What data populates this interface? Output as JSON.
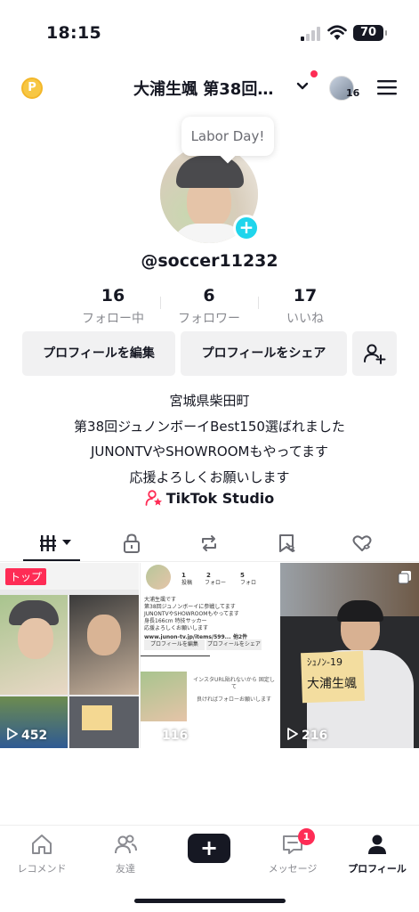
{
  "status": {
    "time": "18:15",
    "battery": "70"
  },
  "header": {
    "title": "大浦生颯 第38回…",
    "avatar_count": "16",
    "coin_label": "P"
  },
  "tooltip": "Labor Day!",
  "profile": {
    "username": "@soccer11232",
    "stats": [
      {
        "num": "16",
        "label": "フォロー中"
      },
      {
        "num": "6",
        "label": "フォロワー"
      },
      {
        "num": "17",
        "label": "いいね"
      }
    ],
    "buttons": {
      "edit": "プロフィールを編集",
      "share": "プロフィールをシェア"
    },
    "bio": [
      "宮城県柴田町",
      "第38回ジュノンボーイBest150選ばれました",
      "JUNONTVやSHOWROOMもやってます",
      "応援よろしくお願いします"
    ],
    "studio": "TikTok Studio"
  },
  "videos": [
    {
      "badge": "トップ",
      "views": "452"
    },
    {
      "views": "116"
    },
    {
      "views": "216"
    }
  ],
  "tile2_text": {
    "stats": [
      "1",
      "2",
      "5"
    ],
    "stat_labels": [
      "投稿",
      "フォロー",
      "フォロ"
    ],
    "bio": [
      "大浦生颯です",
      "第38回ジュノンボーイに参戦してます",
      "JUNONTVやSHOWROOMもやってます",
      "身長166cm 特技サッカー",
      "応援よろしくお願いします"
    ],
    "link": "www.junon-tv.jp/items/599...",
    "other": "他2件",
    "btn_edit": "プロフィールを編集",
    "btn_share": "プロフィールをシェア",
    "note": "インスタURL貼れないから 固定して",
    "note2": "良ければフォローお願いします"
  },
  "tile3_sign": [
    "ｼｭﾉﾝ-19",
    "大浦生颯"
  ],
  "nav": [
    {
      "label": "レコメンド"
    },
    {
      "label": "友達"
    },
    {
      "label": "+"
    },
    {
      "label": "メッセージ",
      "badge": "1"
    },
    {
      "label": "プロフィール"
    }
  ],
  "colors": {
    "accent": "#fe2c55",
    "cyan": "#20d5ec"
  }
}
